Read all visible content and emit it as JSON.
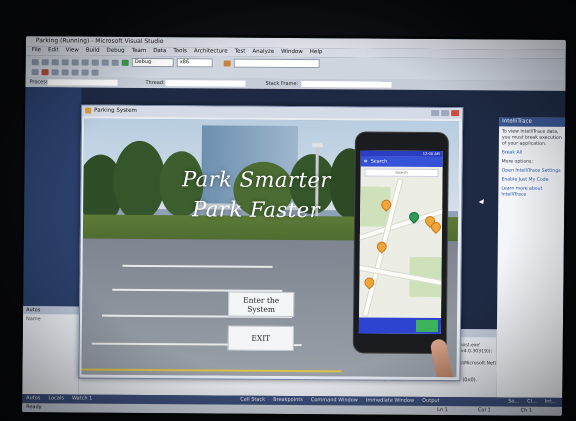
{
  "ide": {
    "title": "Parking (Running) - Microsoft Visual Studio",
    "menu": [
      "File",
      "Edit",
      "View",
      "Build",
      "Debug",
      "Team",
      "Data",
      "Tools",
      "Architecture",
      "Test",
      "Analyze",
      "Window",
      "Help"
    ],
    "toolbar": {
      "config": "Debug",
      "platform": "x86"
    },
    "debug_bar": {
      "process_label": "Process:",
      "thread_label": "Thread:",
      "stack_frame_label": "Stack Frame:"
    },
    "autos_panel": {
      "title": "Autos",
      "column": "Name"
    },
    "intellitrace": {
      "title": "IntelliTrace",
      "lines": [
        "To view IntelliTrace data, you must break execution of your application."
      ],
      "break_all": "Break All",
      "more_options": "More options:",
      "settings": "Open IntelliTrace Settings",
      "just_my_code": "Enable Just My Code",
      "learn_more": "Learn more about IntelliTrace"
    },
    "bottom_text": "The thread '<No Name>' (0x2e8) has exited with code 0 (0x0).",
    "right_panel_text": "'Parking.vshost.exe' (Managed (v4.0.30319)): Loaded 'C:\\Windows\\Microsoft.Net\\...'",
    "bottom_tabs_left": [
      "Autos",
      "Locals",
      "Watch 1"
    ],
    "bottom_tabs_right": [
      "Call Stack",
      "Breakpoints",
      "Command Window",
      "Immediate Window",
      "Output"
    ],
    "right_tabs": [
      "So...",
      "Cl...",
      "Int..."
    ],
    "status": {
      "left": "Ready",
      "ln": "Ln 1",
      "col": "Col 1",
      "ch": "Ch 1"
    }
  },
  "app": {
    "title": "Parking System",
    "tagline_line1": "Park Smarter",
    "tagline_line2": "Park Faster",
    "enter_button": "Enter the System",
    "exit_button": "EXIT",
    "phone": {
      "status_time": "12:00 AM",
      "app_bar_title": "Search",
      "search_placeholder": "Search"
    }
  }
}
